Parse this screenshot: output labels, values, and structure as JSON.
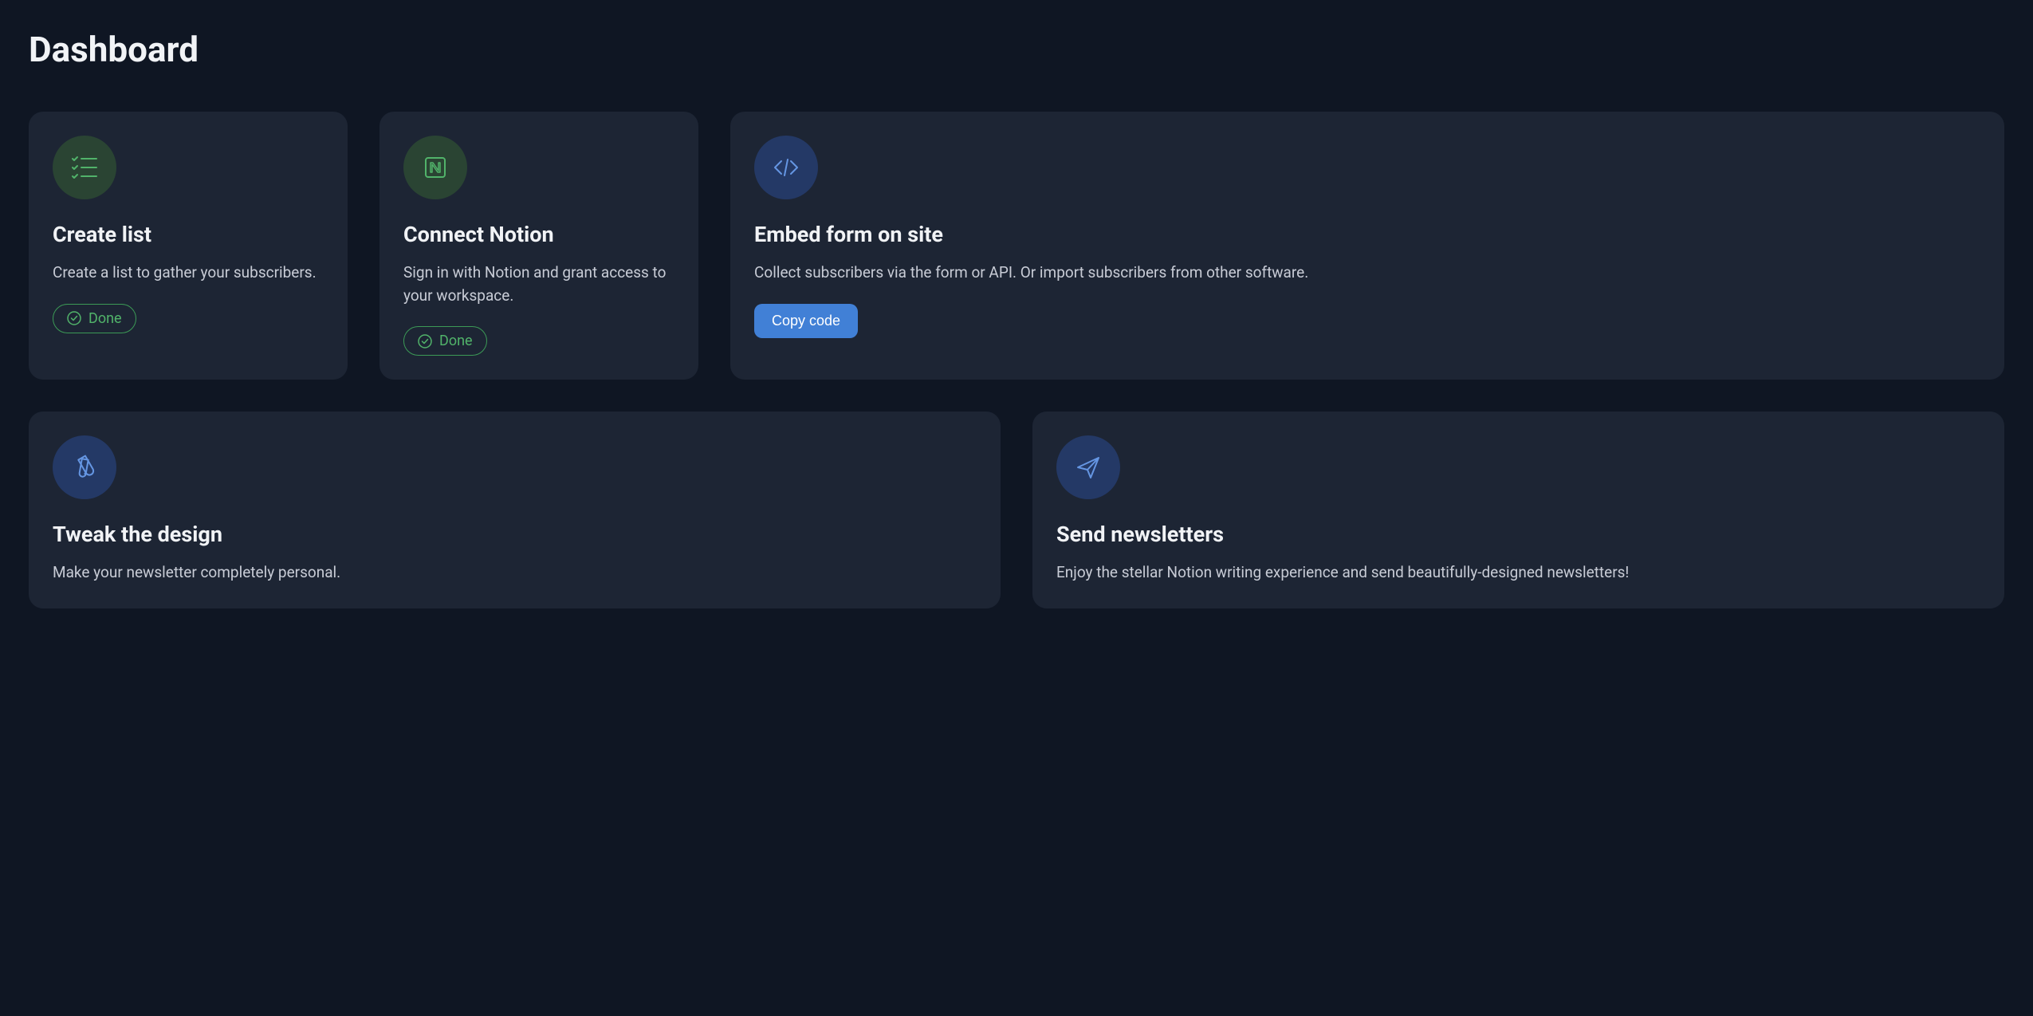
{
  "page_title": "Dashboard",
  "cards": {
    "create_list": {
      "title": "Create list",
      "description": "Create a list to gather your subscribers.",
      "done_label": "Done"
    },
    "connect_notion": {
      "title": "Connect Notion",
      "description": "Sign in with Notion and grant access to your workspace.",
      "done_label": "Done"
    },
    "embed_form": {
      "title": "Embed form on site",
      "description": "Collect subscribers via the form or API. Or import subscribers from other software.",
      "button_label": "Copy code"
    },
    "tweak_design": {
      "title": "Tweak the design",
      "description": "Make your newsletter completely personal."
    },
    "send_newsletters": {
      "title": "Send newsletters",
      "description": "Enjoy the stellar Notion writing experience and send beautifully-designed newsletters!"
    }
  }
}
